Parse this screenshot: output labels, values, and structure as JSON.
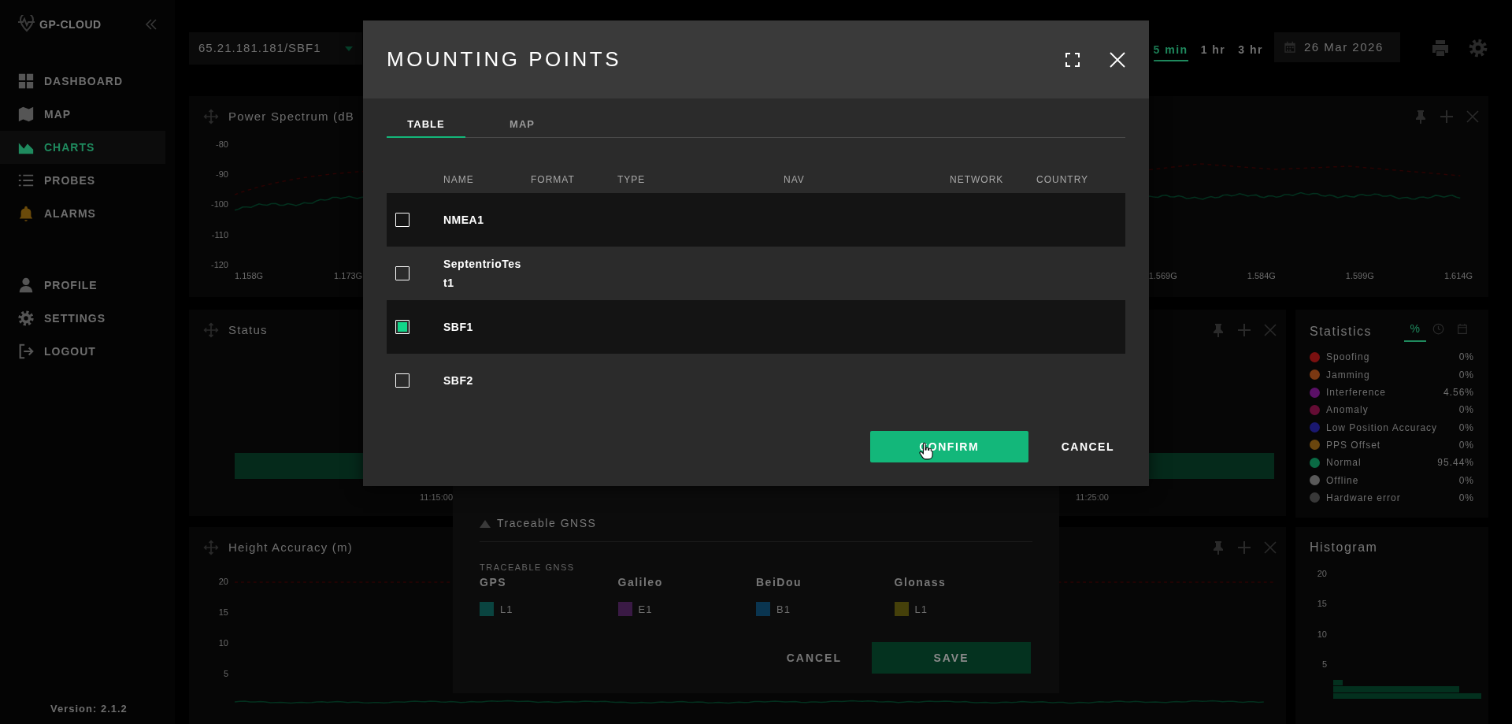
{
  "sidebar": {
    "logo": "GP-CLOUD",
    "items": [
      {
        "label": "DASHBOARD",
        "kind": "grid",
        "selected": false
      },
      {
        "label": "MAP",
        "kind": "map",
        "selected": false
      },
      {
        "label": "CHARTS",
        "kind": "chart",
        "selected": true
      },
      {
        "label": "PROBES",
        "kind": "list",
        "selected": false
      },
      {
        "label": "ALARMS",
        "kind": "bell",
        "selected": false
      }
    ],
    "bottom_items": [
      {
        "label": "PROFILE",
        "kind": "person",
        "selected": false
      },
      {
        "label": "SETTINGS",
        "kind": "gear",
        "selected": false
      },
      {
        "label": "LOGOUT",
        "kind": "logout",
        "selected": false
      }
    ],
    "version": "Version: 2.1.2"
  },
  "toolbar": {
    "probe_select": "65.21.181.181/SBF1",
    "ranges": [
      {
        "label": "5 min",
        "selected": true
      },
      {
        "label": "1 hr",
        "selected": false
      },
      {
        "label": "3 hr",
        "selected": false
      }
    ],
    "date": "26 Mar 2026"
  },
  "power_spectrum": {
    "title": "Power Spectrum (dB",
    "yticks": [
      "-80",
      "-90",
      "-100",
      "-110",
      "-120"
    ],
    "xticks_left": [
      "1.158G",
      "1.173G"
    ],
    "xticks_right": [
      "1.569G",
      "1.584G",
      "1.599G",
      "1.614G"
    ]
  },
  "status": {
    "title": "Status",
    "times": [
      "11:15:00",
      "11:25:00"
    ]
  },
  "height_accuracy": {
    "title": "Height Accuracy (m)",
    "yticks": [
      "20",
      "15",
      "10",
      "5"
    ]
  },
  "statistics": {
    "title": "Statistics",
    "tabs": [
      {
        "kind": "text",
        "label": "%",
        "selected": true
      },
      {
        "kind": "clock",
        "selected": false
      },
      {
        "kind": "calendar",
        "selected": false
      }
    ],
    "rows": [
      {
        "label": "Spoofing",
        "value": "0%",
        "color": "#7a1010"
      },
      {
        "label": "Jamming",
        "value": "0%",
        "color": "#7a3812"
      },
      {
        "label": "Interference",
        "value": "4.56%",
        "color": "#5a1066"
      },
      {
        "label": "Anomaly",
        "value": "0%",
        "color": "#640c34"
      },
      {
        "label": "Low Position Accuracy",
        "value": "0%",
        "color": "#1a1870"
      },
      {
        "label": "PPS Offset",
        "value": "0%",
        "color": "#6a460e"
      },
      {
        "label": "Normal",
        "value": "95.44%",
        "color": "#0a6a44"
      },
      {
        "label": "Offline",
        "value": "0%",
        "color": "#5a5a5a"
      },
      {
        "label": "Hardware error",
        "value": "0%",
        "color": "#383838"
      }
    ]
  },
  "histogram": {
    "title": "Histogram",
    "yticks": [
      "20",
      "15",
      "10",
      "5"
    ]
  },
  "gnss_dialog": {
    "heading": "Traceable GNSS",
    "label": "TRACEABLE GNSS",
    "systems": [
      {
        "name": "GPS",
        "signal": "L1",
        "color": "#0a4440"
      },
      {
        "name": "Galileo",
        "signal": "E1",
        "color": "#3a1a45"
      },
      {
        "name": "BeiDou",
        "signal": "B1",
        "color": "#0a3550"
      },
      {
        "name": "Glonass",
        "signal": "L1",
        "color": "#45400a"
      }
    ],
    "cancel": "CANCEL",
    "save": "SAVE"
  },
  "modal": {
    "title": "MOUNTING POINTS",
    "tabs": [
      {
        "label": "TABLE",
        "selected": true
      },
      {
        "label": "MAP",
        "selected": false
      }
    ],
    "columns": [
      "NAME",
      "FORMAT",
      "TYPE",
      "NAV",
      "NETWORK",
      "COUNTRY"
    ],
    "rows": [
      {
        "name": "NMEA1",
        "checked": false
      },
      {
        "name": "SeptentrioTest1",
        "checked": false
      },
      {
        "name": "SBF1",
        "checked": true
      },
      {
        "name": "SBF2",
        "checked": false
      }
    ],
    "confirm": "CONFIRM",
    "cancel": "CANCEL"
  }
}
